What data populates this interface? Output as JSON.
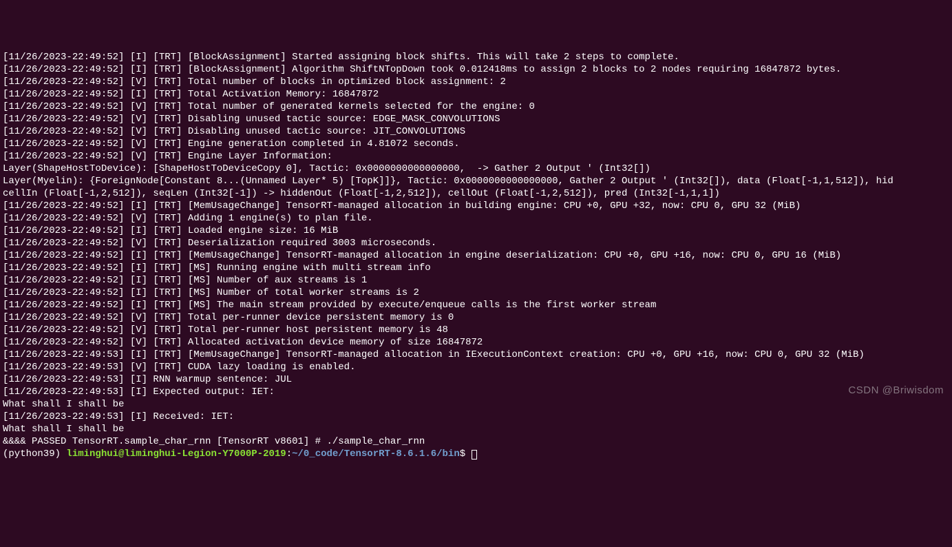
{
  "lines": [
    "[11/26/2023-22:49:52] [I] [TRT] [BlockAssignment] Started assigning block shifts. This will take 2 steps to complete.",
    "[11/26/2023-22:49:52] [I] [TRT] [BlockAssignment] Algorithm ShiftNTopDown took 0.012418ms to assign 2 blocks to 2 nodes requiring 16847872 bytes.",
    "[11/26/2023-22:49:52] [V] [TRT] Total number of blocks in optimized block assignment: 2",
    "[11/26/2023-22:49:52] [I] [TRT] Total Activation Memory: 16847872",
    "[11/26/2023-22:49:52] [V] [TRT] Total number of generated kernels selected for the engine: 0",
    "[11/26/2023-22:49:52] [V] [TRT] Disabling unused tactic source: EDGE_MASK_CONVOLUTIONS",
    "[11/26/2023-22:49:52] [V] [TRT] Disabling unused tactic source: JIT_CONVOLUTIONS",
    "[11/26/2023-22:49:52] [V] [TRT] Engine generation completed in 4.81072 seconds.",
    "[11/26/2023-22:49:52] [V] [TRT] Engine Layer Information:",
    "Layer(ShapeHostToDevice): [ShapeHostToDeviceCopy 0], Tactic: 0x0000000000000000,  -> Gather 2 Output ' (Int32[])",
    "Layer(Myelin): {ForeignNode[Constant 8...(Unnamed Layer* 5) [TopK]]}, Tactic: 0x0000000000000000, Gather 2 Output ' (Int32[]), data (Float[-1,1,512]), hid",
    "cellIn (Float[-1,2,512]), seqLen (Int32[-1]) -> hiddenOut (Float[-1,2,512]), cellOut (Float[-1,2,512]), pred (Int32[-1,1,1])",
    "[11/26/2023-22:49:52] [I] [TRT] [MemUsageChange] TensorRT-managed allocation in building engine: CPU +0, GPU +32, now: CPU 0, GPU 32 (MiB)",
    "[11/26/2023-22:49:52] [V] [TRT] Adding 1 engine(s) to plan file.",
    "[11/26/2023-22:49:52] [I] [TRT] Loaded engine size: 16 MiB",
    "[11/26/2023-22:49:52] [V] [TRT] Deserialization required 3003 microseconds.",
    "[11/26/2023-22:49:52] [I] [TRT] [MemUsageChange] TensorRT-managed allocation in engine deserialization: CPU +0, GPU +16, now: CPU 0, GPU 16 (MiB)",
    "[11/26/2023-22:49:52] [I] [TRT] [MS] Running engine with multi stream info",
    "[11/26/2023-22:49:52] [I] [TRT] [MS] Number of aux streams is 1",
    "[11/26/2023-22:49:52] [I] [TRT] [MS] Number of total worker streams is 2",
    "[11/26/2023-22:49:52] [I] [TRT] [MS] The main stream provided by execute/enqueue calls is the first worker stream",
    "[11/26/2023-22:49:52] [V] [TRT] Total per-runner device persistent memory is 0",
    "[11/26/2023-22:49:52] [V] [TRT] Total per-runner host persistent memory is 48",
    "[11/26/2023-22:49:52] [V] [TRT] Allocated activation device memory of size 16847872",
    "[11/26/2023-22:49:53] [I] [TRT] [MemUsageChange] TensorRT-managed allocation in IExecutionContext creation: CPU +0, GPU +16, now: CPU 0, GPU 32 (MiB)",
    "[11/26/2023-22:49:53] [V] [TRT] CUDA lazy loading is enabled.",
    "[11/26/2023-22:49:53] [I] RNN warmup sentence: JUL",
    "[11/26/2023-22:49:53] [I] Expected output: IET:",
    "What shall I shall be",
    "[11/26/2023-22:49:53] [I] Received: IET:",
    "What shall I shall be",
    "&&&& PASSED TensorRT.sample_char_rnn [TensorRT v8601] # ./sample_char_rnn"
  ],
  "prompt": {
    "env": "(python39) ",
    "user": "liminghui@liminghui-Legion-Y7000P-2019",
    "path": "~/0_code/TensorRT-8.6.1.6/bin",
    "sep": ":",
    "dollar": "$ "
  },
  "watermark": "CSDN @Briwisdom"
}
